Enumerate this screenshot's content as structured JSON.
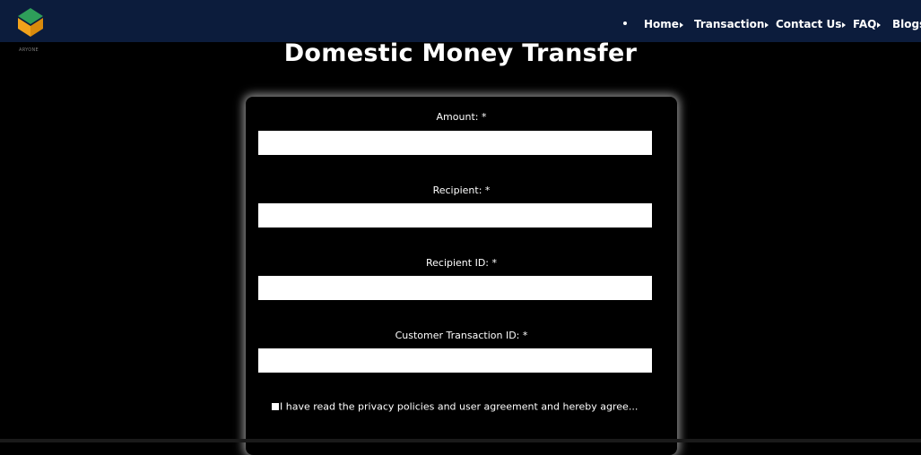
{
  "brand": {
    "logo_text": "ARYONE"
  },
  "nav": {
    "items": [
      {
        "label": "Home"
      },
      {
        "label": "Transaction"
      },
      {
        "label": "Contact Us"
      },
      {
        "label": "FAQ"
      },
      {
        "label": "Blogs"
      }
    ]
  },
  "page": {
    "title": "Domestic Money Transfer"
  },
  "form": {
    "fields": [
      {
        "label": "Amount: *",
        "value": ""
      },
      {
        "label": "Recipient: *",
        "value": ""
      },
      {
        "label": "Recipient ID: *",
        "value": ""
      },
      {
        "label": "Customer Transaction ID: *",
        "value": ""
      }
    ],
    "agreement_text": "I have read the privacy policies and user agreement and hereby agree..."
  },
  "colors": {
    "navbar": "#0c1c3c",
    "background": "#000000",
    "logo_green": "#2e9e5a",
    "logo_orange": "#f2a21b"
  }
}
